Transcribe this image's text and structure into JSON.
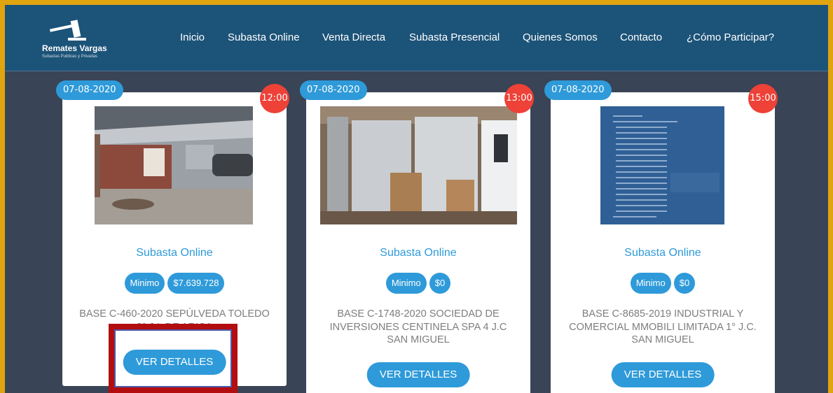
{
  "brand": {
    "title": "Remates Vargas",
    "subtitle": "Subastas Publicas y Privadas"
  },
  "nav": [
    {
      "label": "Inicio"
    },
    {
      "label": "Subasta Online"
    },
    {
      "label": "Venta Directa"
    },
    {
      "label": "Subasta Presencial"
    },
    {
      "label": "Quienes Somos"
    },
    {
      "label": "Contacto"
    },
    {
      "label": "¿Cómo Participar?"
    }
  ],
  "cards": [
    {
      "date": "07-08-2020",
      "time": "12:00",
      "image": "property-photo",
      "type": "Subasta Online",
      "min_label": "Minimo",
      "min_value": "$7.639.728",
      "description": "BASE C-460-2020 SEPÚLVEDA TOLEDO 2° J.L DE ARICA",
      "button": "VER DETALLES"
    },
    {
      "date": "07-08-2020",
      "time": "13:00",
      "image": "appliances-photo",
      "type": "Subasta Online",
      "min_label": "Minimo",
      "min_value": "$0",
      "description": "BASE C-1748-2020 SOCIEDAD DE INVERSIONES CENTINELA SPA 4 J.C SAN MIGUEL",
      "button": "VER DETALLES"
    },
    {
      "date": "07-08-2020",
      "time": "15:00",
      "image": "document-photo",
      "type": "Subasta Online",
      "min_label": "Minimo",
      "min_value": "$0",
      "description": "BASE C-8685-2019 INDUSTRIAL Y COMERCIAL MMOBILI LIMITADA 1° J.C. SAN MIGUEL",
      "button": "VER DETALLES"
    }
  ],
  "colors": {
    "frame": "#e0a50e",
    "navbar": "#1c5378",
    "page_bg": "#394456",
    "accent": "#2e9ad9",
    "time_badge": "#ee4137",
    "highlight": "#b30d10"
  }
}
